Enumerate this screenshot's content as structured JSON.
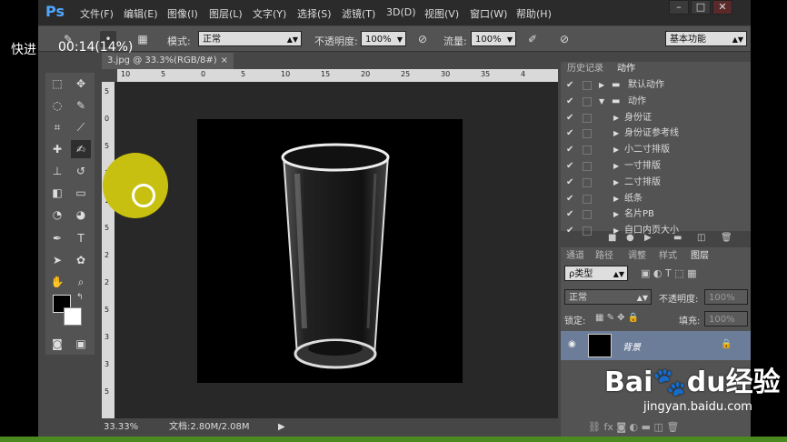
{
  "overlay": {
    "label": "快进",
    "time": "00:14(14%)"
  },
  "app": {
    "logo": "Ps",
    "menu": [
      "文件(F)",
      "编辑(E)",
      "图像(I)",
      "图层(L)",
      "文字(Y)",
      "选择(S)",
      "滤镜(T)",
      "3D(D)",
      "视图(V)",
      "窗口(W)",
      "帮助(H)"
    ],
    "window_buttons": [
      "–",
      "□",
      "✕"
    ]
  },
  "options": {
    "mode_label": "模式:",
    "mode_value": "正常",
    "opacity_label": "不透明度:",
    "opacity_value": "100%",
    "flow_label": "流量:",
    "flow_value": "100%",
    "workspace": "基本功能"
  },
  "document": {
    "tab": "3.jpg @ 33.3%(RGB/8#)",
    "zoom": "33.33%",
    "doc_info": "文档:2.80M/2.08M",
    "ruler_h": [
      "10",
      "5",
      "0",
      "5",
      "10",
      "15",
      "20",
      "25",
      "30",
      "35",
      "4"
    ],
    "ruler_v": [
      "5",
      "0",
      "5",
      "1",
      "1",
      "5",
      "2",
      "2",
      "5",
      "3",
      "3",
      "5"
    ]
  },
  "actions_panel": {
    "tabs": [
      "历史记录",
      "动作"
    ],
    "items": [
      {
        "label": "默认动作",
        "level": 0,
        "expanded": false
      },
      {
        "label": "动作",
        "level": 0,
        "expanded": true
      },
      {
        "label": "身份证",
        "level": 1
      },
      {
        "label": "身份证参考线",
        "level": 1
      },
      {
        "label": "小二寸排版",
        "level": 1
      },
      {
        "label": "一寸排版",
        "level": 1
      },
      {
        "label": "二寸排版",
        "level": 1
      },
      {
        "label": "纸条",
        "level": 1
      },
      {
        "label": "名片PB",
        "level": 1
      },
      {
        "label": "自口内页大小",
        "level": 1
      }
    ]
  },
  "layers_panel": {
    "tabs": [
      "通道",
      "路径",
      "调整",
      "样式",
      "图层"
    ],
    "filter": "ρ类型",
    "blend": "正常",
    "opacity_label": "不透明度:",
    "opacity_value": "100%",
    "lock_label": "锁定:",
    "fill_label": "填充:",
    "fill_value": "100%",
    "layer_name": "背景"
  },
  "watermark": {
    "brand": "Bai",
    "brand2": "du",
    "brand3": "经验",
    "url": "jingyan.baidu.com"
  }
}
